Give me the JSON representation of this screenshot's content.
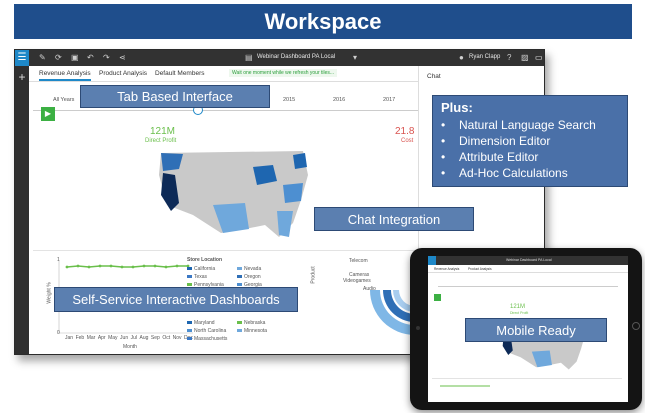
{
  "banner": {
    "title": "Workspace"
  },
  "app": {
    "title": "Webinar Dashboard PA Local",
    "user": "Ryan Clapp",
    "notice": "Wait one moment while we refresh your tiles...",
    "tabs": [
      "Revenue Analysis",
      "Product Analysis",
      "Default Members"
    ],
    "chat_label": "Chat",
    "timeline": {
      "labels": [
        "All Years",
        "2015",
        "2016",
        "2017"
      ]
    },
    "kpis": [
      {
        "value": "121M",
        "label": "Direct Profit"
      },
      {
        "value": "21.8",
        "label": "Cost"
      }
    ],
    "line_chart": {
      "ylabel": "Weight %",
      "xlabel": "Month",
      "months": [
        "Jan",
        "Feb",
        "Mar",
        "Apr",
        "May",
        "Jun",
        "Jul",
        "Aug",
        "Sep",
        "Oct",
        "Nov",
        "Dec"
      ],
      "yticks": [
        "1",
        "0"
      ]
    },
    "store_legend": {
      "title": "Store Location",
      "items": [
        "California",
        "Nevada",
        "Texas",
        "Oregon",
        "Pennsylvania",
        "Georgia",
        "Maryland",
        "Nebraska",
        "North Carolina",
        "Minnesota",
        "Massachusetts"
      ]
    },
    "product_label": "Product",
    "product_items": [
      "Telecom",
      "Cameras",
      "Videogames",
      "Audio"
    ]
  },
  "callouts": {
    "tab_interface": "Tab Based Interface",
    "chat_integration": "Chat Integration",
    "self_service": "Self-Service Interactive Dashboards",
    "mobile_ready": "Mobile Ready"
  },
  "plus_box": {
    "title": "Plus:",
    "items": [
      "Natural Language Search",
      "Dimension Editor",
      "Attribute Editor",
      "Ad-Hoc Calculations"
    ]
  },
  "tablet": {
    "title": "Webinar Dashboard PA Local",
    "tabs": [
      "Revenue Analysis",
      "Product Analysis"
    ],
    "kpi_value": "121M",
    "kpi_label": "Direct Profit"
  },
  "colors": {
    "banner": "#1f4e8c",
    "accent": "#1e88c8",
    "callout": "#5b7fb0",
    "positive": "#6abf4b",
    "negative": "#d9534f"
  }
}
